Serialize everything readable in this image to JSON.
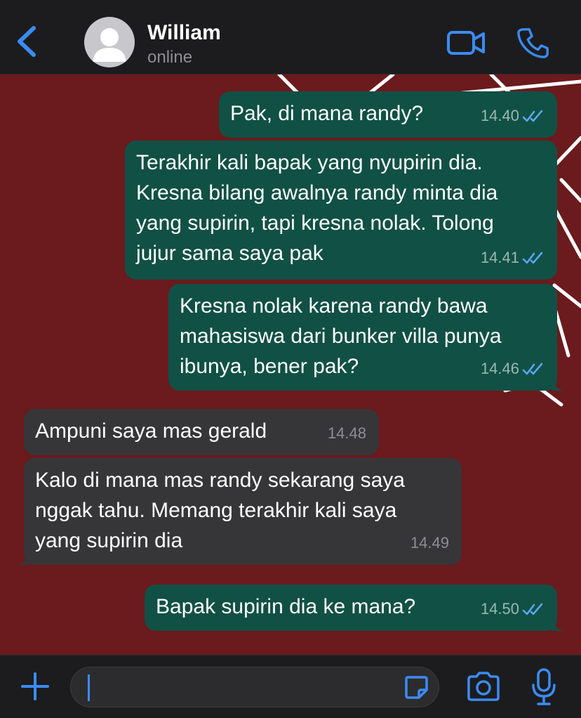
{
  "header": {
    "contact_name": "William",
    "contact_status": "online",
    "icons": {
      "back": "chevron-left-icon",
      "avatar": "person-avatar-icon",
      "video": "video-camera-icon",
      "call": "phone-icon"
    }
  },
  "messages": [
    {
      "direction": "outgoing",
      "text": "Pak, di mana randy?",
      "time": "14.40",
      "read": true
    },
    {
      "direction": "outgoing",
      "text": "Terakhir kali bapak yang nyupirin dia.\nKresna bilang awalnya randy minta dia\nyang supirin, tapi kresna nolak. Tolong\njujur sama saya pak",
      "time": "14.41",
      "read": true
    },
    {
      "direction": "outgoing",
      "text": "Kresna nolak karena randy bawa\nmahasiswa dari bunker villa punya\nibunya, bener pak?",
      "time": "14.46",
      "read": true
    },
    {
      "direction": "incoming",
      "text": "Ampuni saya mas gerald",
      "time": "14.48"
    },
    {
      "direction": "incoming",
      "text": "Kalo di mana mas randy sekarang saya\nnggak tahu. Memang terakhir kali saya\nyang supirin dia",
      "time": "14.49"
    },
    {
      "direction": "outgoing",
      "text": "Bapak supirin dia ke mana?",
      "time": "14.50",
      "read": true
    }
  ],
  "input_bar": {
    "message_value": "",
    "icons": {
      "plus": "plus-icon",
      "sticker": "sticker-icon",
      "camera": "camera-icon",
      "mic": "microphone-icon"
    }
  },
  "colors": {
    "header_bg": "#1c1c1e",
    "accent": "#3b8cf6",
    "wallpaper": "#6b1a1d",
    "outgoing_bubble": "#115045",
    "incoming_bubble": "#363638",
    "read_ticks": "#5aa9f5"
  }
}
